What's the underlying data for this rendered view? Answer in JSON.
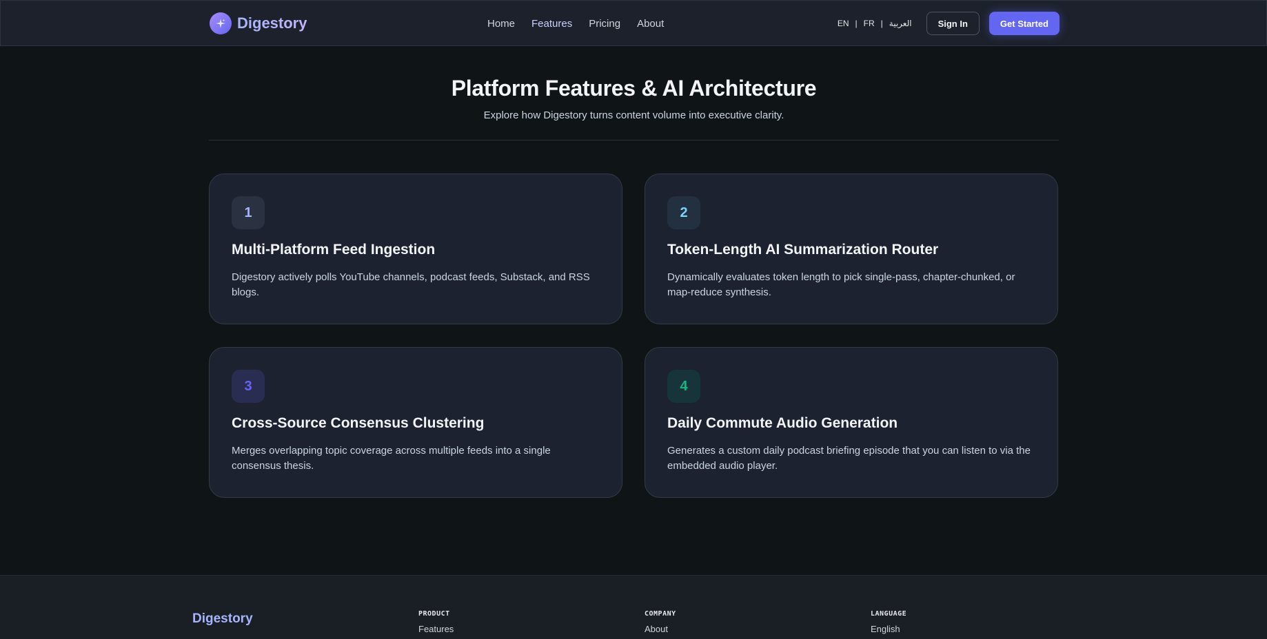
{
  "header": {
    "brand": "Digestory",
    "nav": [
      {
        "label": "Home"
      },
      {
        "label": "Features"
      },
      {
        "label": "Pricing"
      },
      {
        "label": "About"
      }
    ],
    "languages": [
      "EN",
      "FR",
      "العربية"
    ],
    "separator": "|",
    "sign_in_label": "Sign In",
    "get_started_label": "Get Started"
  },
  "hero": {
    "title": "Platform Features & AI Architecture",
    "subtitle": "Explore how Digestory turns content volume into executive clarity."
  },
  "features": [
    {
      "number": "1",
      "title": "Multi-Platform Feed Ingestion",
      "description": "Digestory actively polls YouTube channels, podcast feeds, Substack, and RSS blogs."
    },
    {
      "number": "2",
      "title": "Token-Length AI Summarization Router",
      "description": "Dynamically evaluates token length to pick single-pass, chapter-chunked, or map-reduce synthesis."
    },
    {
      "number": "3",
      "title": "Cross-Source Consensus Clustering",
      "description": "Merges overlapping topic coverage across multiple feeds into a single consensus thesis."
    },
    {
      "number": "4",
      "title": "Daily Commute Audio Generation",
      "description": "Generates a custom daily podcast briefing episode that you can listen to via the embedded audio player."
    }
  ],
  "footer": {
    "brand": "Digestory",
    "columns": [
      {
        "heading": "PRODUCT",
        "link": "Features"
      },
      {
        "heading": "COMPANY",
        "link": "About"
      },
      {
        "heading": "LANGUAGE",
        "link": "English"
      }
    ]
  },
  "colors": {
    "accent": "#6366f1",
    "badge_1_bg": "#2a3140",
    "badge_1_fg": "#a5b4fc",
    "badge_2_bg": "#23303f",
    "badge_2_fg": "#7dd3fc",
    "badge_3_bg": "#2a2d52",
    "badge_3_fg": "#6366f1",
    "badge_4_bg": "#16343a",
    "badge_4_fg": "#10b981"
  },
  "icons": {
    "brand_logo": "sparkles-icon"
  }
}
